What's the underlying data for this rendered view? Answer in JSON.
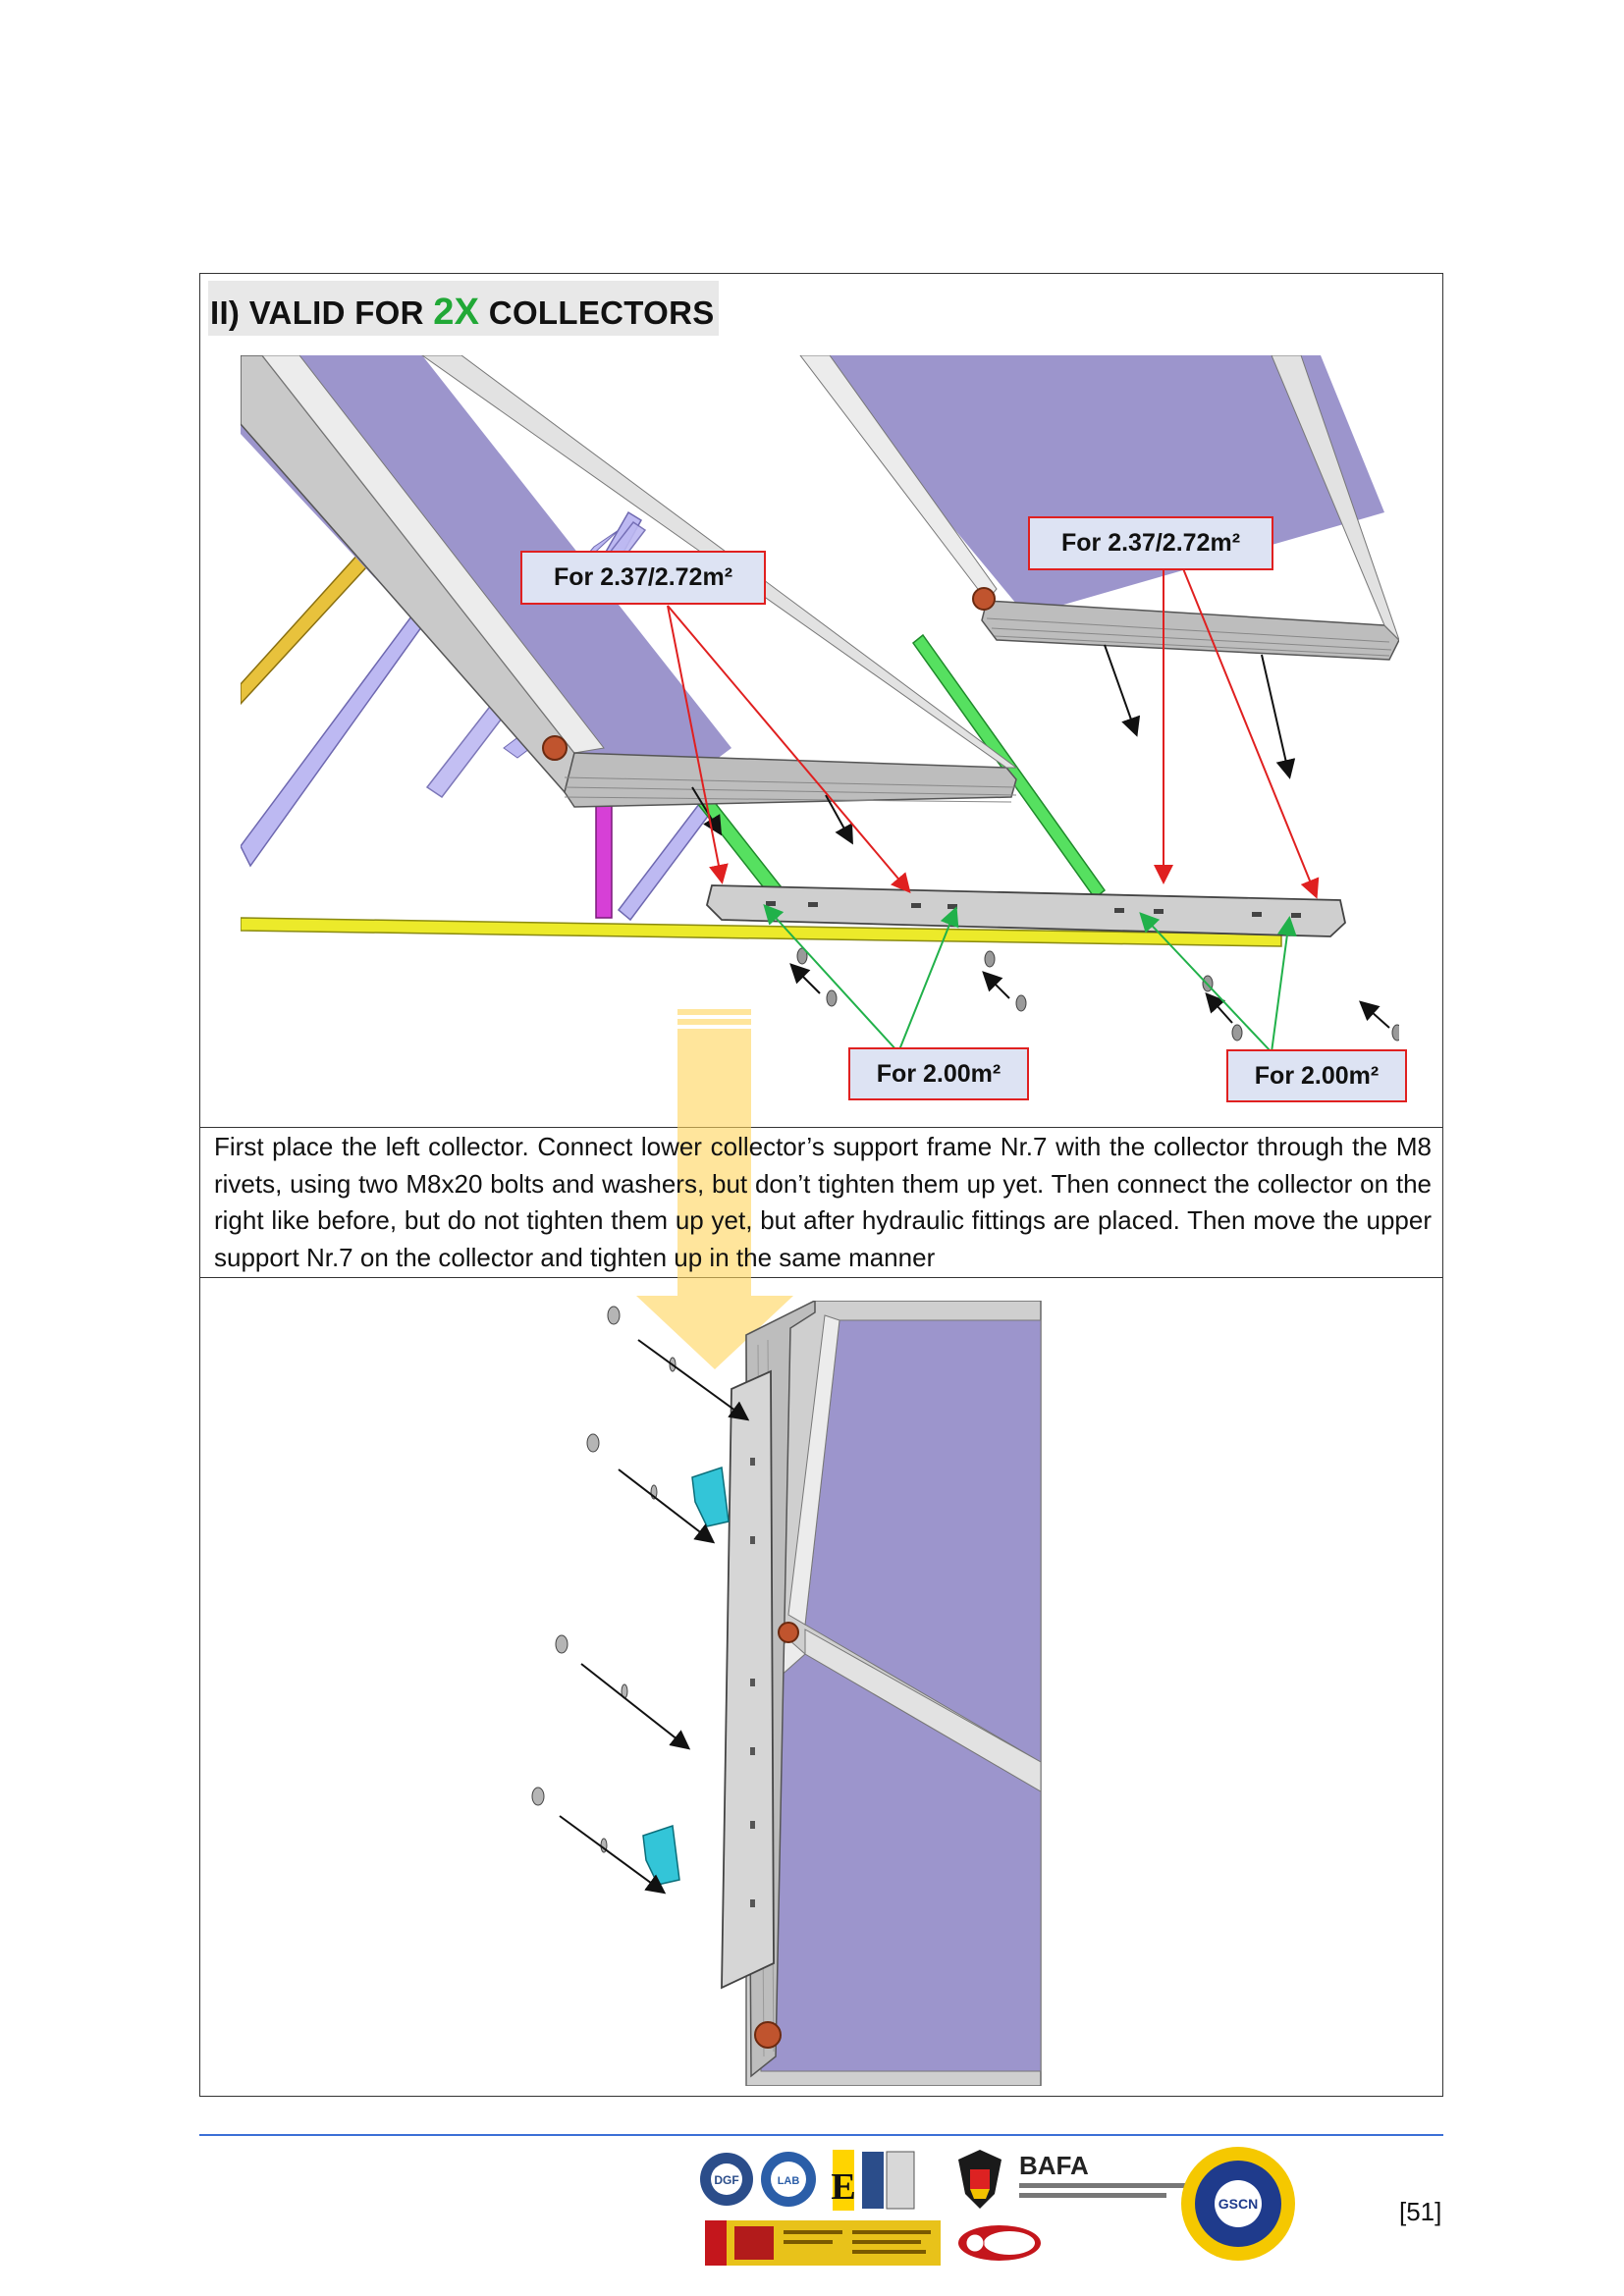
{
  "section": {
    "title_prefix": "II) VALID FOR ",
    "title_highlight": "2X",
    "title_suffix": " COLLECTORS"
  },
  "callouts": {
    "top_left": "For 2.37/2.72m²",
    "top_right": "For 2.37/2.72m²",
    "bottom_left": "For 2.00m²",
    "bottom_right": "For 2.00m²"
  },
  "description": "First place the left collector. Connect lower collector’s support frame Nr.7 with the collector through the M8 rivets, using two M8x20 bolts and washers, but don’t tighten them up yet. Then connect the collector on the right like before, but do not tighten them up yet, but after hydraulic fittings are placed. Then move the upper support Nr.7 on the collector and tighten up in the same manner",
  "footer": {
    "page_number": "[51]",
    "logos": [
      "DGF",
      "LAB",
      "E",
      "CSCN",
      "BAFA",
      "GOBIERNO DE ESPAÑA",
      "MINISTERIO DE ENERGÍA, TURISMO Y AGENDA DIGITAL",
      "SRCC"
    ]
  },
  "colors": {
    "accent_green": "#21a836",
    "callout_border": "#e02020",
    "callout_fill": "#dde3f3",
    "collector_glass": "#9c95cc",
    "footer_rule": "#3b6fd6"
  }
}
